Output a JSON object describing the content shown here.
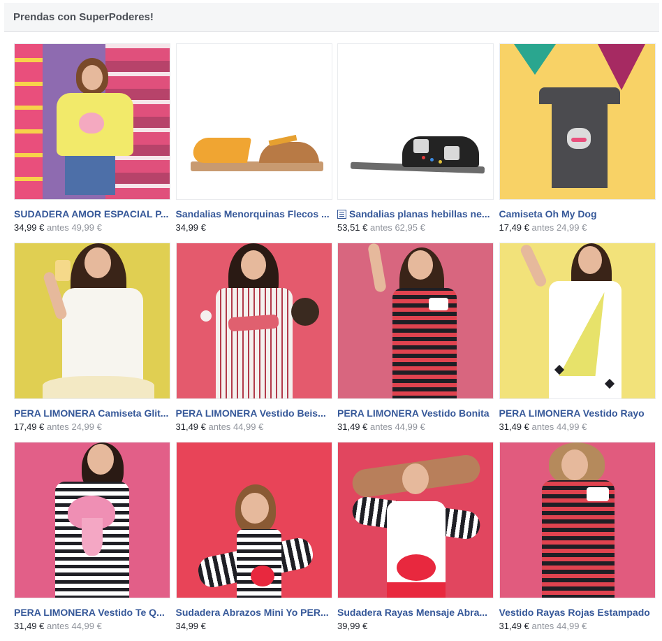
{
  "header": {
    "title": "Prendas con SuperPoderes!"
  },
  "icons": {
    "catalog": "catalog-icon"
  },
  "products": [
    {
      "name": "SUDADERA AMOR ESPACIAL P...",
      "price": "34,99 €",
      "old_label": "antes",
      "old_price": "49,99 €"
    },
    {
      "name": "Sandalias Menorquinas Flecos ...",
      "price": "34,99 €",
      "old_label": "",
      "old_price": ""
    },
    {
      "name": "Sandalias planas hebillas ne...",
      "price": "53,51 €",
      "old_label": "antes",
      "old_price": "62,95 €",
      "icon": "catalog-icon"
    },
    {
      "name": "Camiseta Oh My Dog",
      "price": "17,49 €",
      "old_label": "antes",
      "old_price": "24,99 €"
    },
    {
      "name": "PERA LIMONERA Camiseta Glit...",
      "price": "17,49 €",
      "old_label": "antes",
      "old_price": "24,99 €"
    },
    {
      "name": "PERA LIMONERA Vestido Beis...",
      "price": "31,49 €",
      "old_label": "antes",
      "old_price": "44,99 €"
    },
    {
      "name": "PERA LIMONERA Vestido Bonita",
      "price": "31,49 €",
      "old_label": "antes",
      "old_price": "44,99 €"
    },
    {
      "name": "PERA LIMONERA Vestido Rayo",
      "price": "31,49 €",
      "old_label": "antes",
      "old_price": "44,99 €"
    },
    {
      "name": "PERA LIMONERA Vestido Te Q...",
      "price": "31,49 €",
      "old_label": "antes",
      "old_price": "44,99 €"
    },
    {
      "name": "Sudadera Abrazos Mini Yo PER...",
      "price": "34,99 €",
      "old_label": "",
      "old_price": ""
    },
    {
      "name": "Sudadera Rayas Mensaje Abra...",
      "price": "39,99 €",
      "old_label": "",
      "old_price": ""
    },
    {
      "name": "Vestido Rayas Rojas Estampado",
      "price": "31,49 €",
      "old_label": "antes",
      "old_price": "44,99 €"
    }
  ],
  "colors": {
    "link": "#365899",
    "muted": "#90949c",
    "header_bg": "#f5f6f7"
  }
}
